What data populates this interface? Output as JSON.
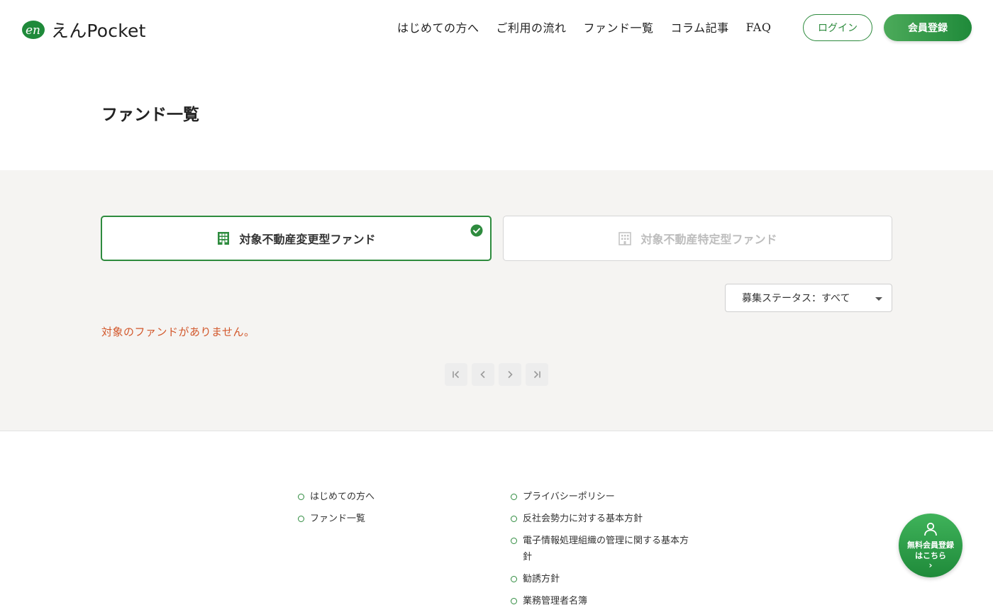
{
  "header": {
    "logo_text": "えんPocket",
    "nav": [
      "はじめての方へ",
      "ご利用の流れ",
      "ファンド一覧",
      "コラム記事",
      "FAQ"
    ],
    "login_label": "ログイン",
    "register_label": "会員登録"
  },
  "page": {
    "title": "ファンド一覧"
  },
  "tabs": [
    {
      "label": "対象不動産変更型ファンド",
      "selected": true
    },
    {
      "label": "対象不動産特定型ファンド",
      "selected": false
    }
  ],
  "filter": {
    "status_label": "募集ステータス：すべて"
  },
  "results": {
    "empty_message": "対象のファンドがありません。"
  },
  "footer": {
    "col1": [
      "はじめての方へ",
      "ファンド一覧"
    ],
    "col2": [
      "プライバシーポリシー",
      "反社会勢力に対する基本方針",
      "電子情報処理組織の管理に関する基本方針",
      "勧誘方針",
      "業務管理者名簿"
    ]
  },
  "cta": {
    "line1": "無料会員登録",
    "line2": "はこちら",
    "arrow": "›"
  },
  "colors": {
    "brand_green": "#2e8b3e",
    "error_orange": "#d2572b",
    "section_bg": "#f5f4f2"
  }
}
